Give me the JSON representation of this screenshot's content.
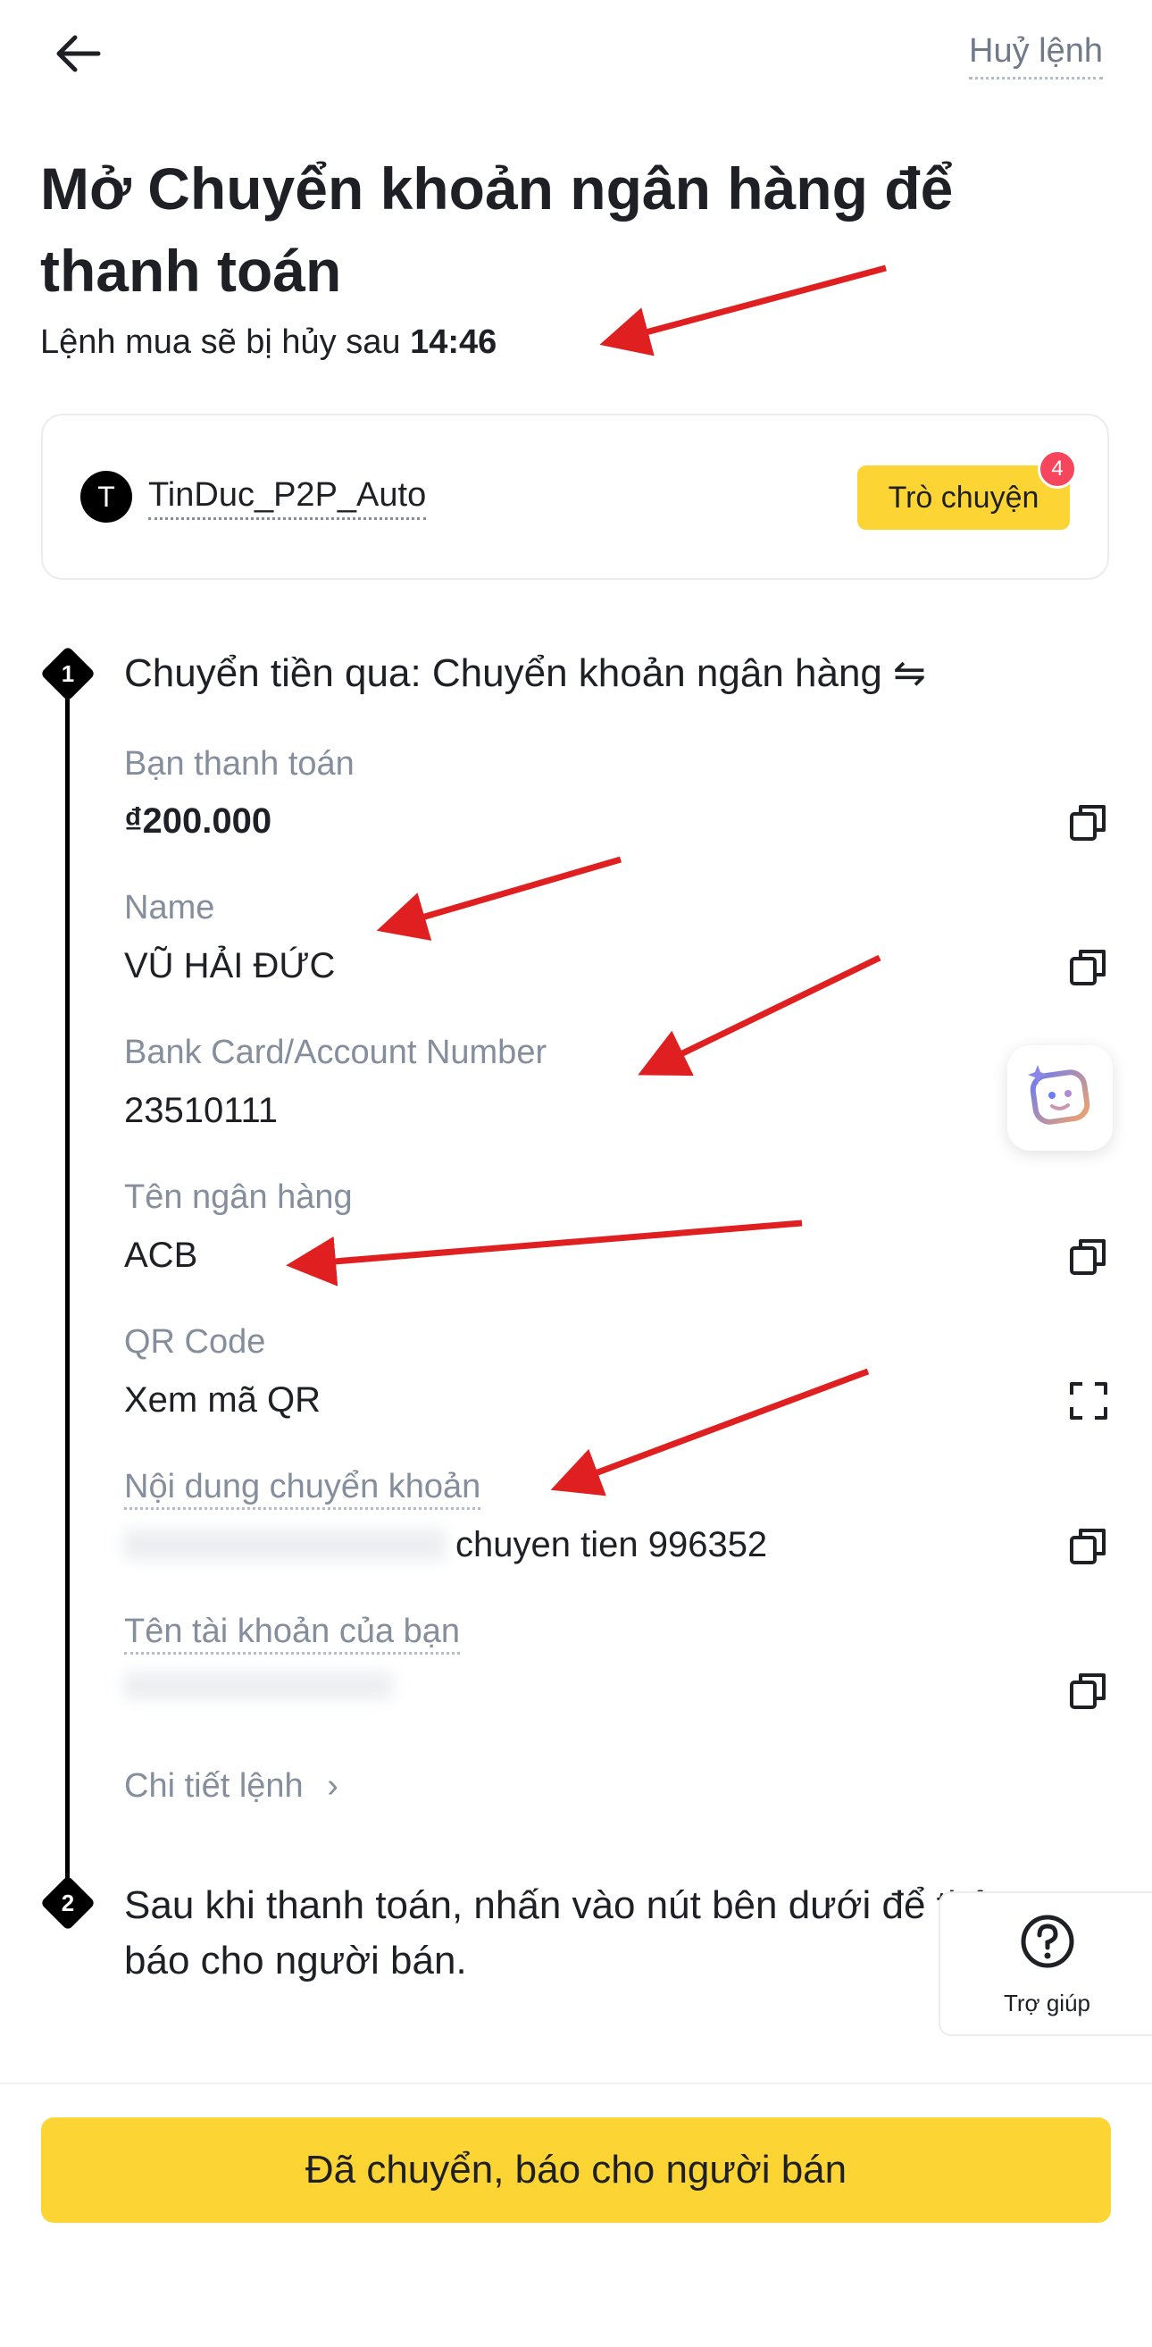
{
  "header": {
    "back_icon": "arrow-left-icon",
    "cancel_label": "Huỷ lệnh"
  },
  "title": "Mở Chuyển khoản ngân hàng để thanh toán",
  "timer": {
    "prefix": "Lệnh mua sẽ bị hủy sau",
    "time": "14:46"
  },
  "merchant": {
    "avatar_letter": "T",
    "name": "TinDuc_P2P_Auto",
    "chat_label": "Trò chuyện",
    "chat_badge": "4"
  },
  "step1": {
    "number": "1",
    "title": "Chuyển tiền qua:  Chuyển khoản ngân hàng ⇋",
    "fields": [
      {
        "label": "Bạn thanh toán",
        "value": "₫200.000",
        "action_icon": "copy-icon"
      },
      {
        "label": "Name",
        "value": "VŨ HẢI ĐỨC",
        "action_icon": "copy-icon"
      },
      {
        "label": "Bank Card/Account Number",
        "value": "23510111",
        "action_icon": "none"
      },
      {
        "label": "Tên ngân hàng",
        "value": "ACB",
        "action_icon": "copy-icon"
      },
      {
        "label": "QR Code",
        "value": "Xem mã QR",
        "action_icon": "expand-icon"
      },
      {
        "label": "Nội dung chuyển khoản",
        "value": "chuyen tien 996352",
        "action_icon": "copy-icon"
      },
      {
        "label": "Tên tài khoản của bạn",
        "value": "",
        "action_icon": "copy-icon"
      }
    ],
    "details_link": "Chi tiết lệnh",
    "details_chevron": "›"
  },
  "step2": {
    "number": "2",
    "title": "Sau khi thanh toán, nhấn vào nút bên dưới để thông báo cho người bán."
  },
  "help": {
    "icon": "question-circle-icon",
    "label": "Trợ giúp"
  },
  "assistant": {
    "icon": "ai-assistant-icon"
  },
  "footer": {
    "primary_button": "Đã chuyển, báo cho người bán"
  },
  "colors": {
    "accent": "#fcd535",
    "badge": "#f6465d",
    "annotation_arrow": "#e02020",
    "text_primary": "#1e2026",
    "text_secondary": "#848e9c"
  }
}
